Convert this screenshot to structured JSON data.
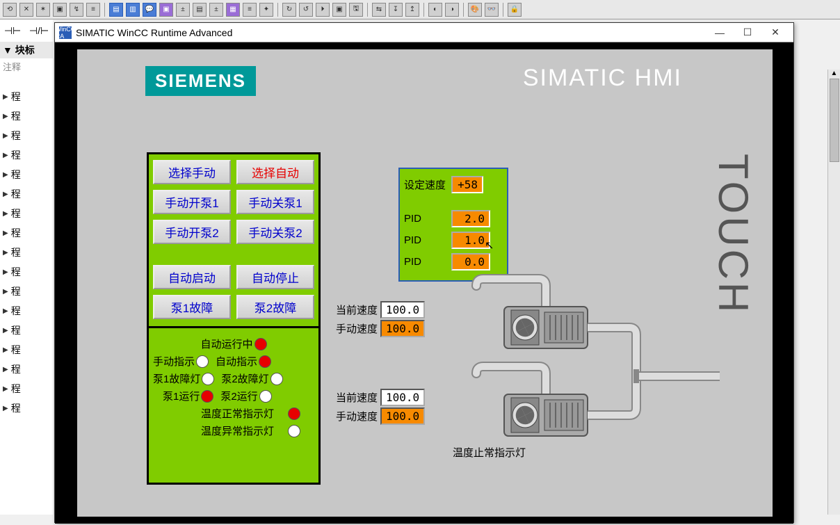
{
  "window": {
    "title": "SIMATIC WinCC Runtime Advanced",
    "iconText": "WinCC RA"
  },
  "branding": {
    "logo": "SIEMENS",
    "product": "SIMATIC HMI",
    "touch": "TOUCH"
  },
  "sidebar": {
    "header": "▼ 块标",
    "note": "注释",
    "item": "程"
  },
  "symbols": {
    "rung": "⊣⊢",
    "rung2": "⊣/⊢"
  },
  "buttons": {
    "selectManual": "选择手动",
    "selectAuto": "选择自动",
    "manualOpen1": "手动开泵1",
    "manualClose1": "手动关泵1",
    "manualOpen2": "手动开泵2",
    "manualClose2": "手动关泵2",
    "autoStart": "自动启动",
    "autoStop": "自动停止",
    "pump1Fault": "泵1故障",
    "pump2Fault": "泵2故障"
  },
  "status": {
    "autoRunning": "自动运行中",
    "manualInd": "手动指示",
    "autoInd": "自动指示",
    "pump1FaultLamp": "泵1故障灯",
    "pump2FaultLamp": "泵2故障灯",
    "pump1Run": "泵1运行",
    "pump2Run": "泵2运行",
    "tempNormal": "温度正常指示灯",
    "tempAbnormal": "温度异常指示灯"
  },
  "pid": {
    "setSpeedLabel": "设定速度",
    "setSpeedValue": "+58",
    "label": "PID",
    "p": "2.0",
    "i": "1.0",
    "d": "0.0"
  },
  "pump1": {
    "curSpeedLabel": "当前速度",
    "curSpeed": "100.0",
    "manSpeedLabel": "手动速度",
    "manSpeed": "100.0"
  },
  "pump2": {
    "curSpeedLabel": "当前速度",
    "curSpeed": "100.0",
    "manSpeedLabel": "手动速度",
    "manSpeed": "100.0"
  },
  "bottomLabel": "温度止常指示灯"
}
